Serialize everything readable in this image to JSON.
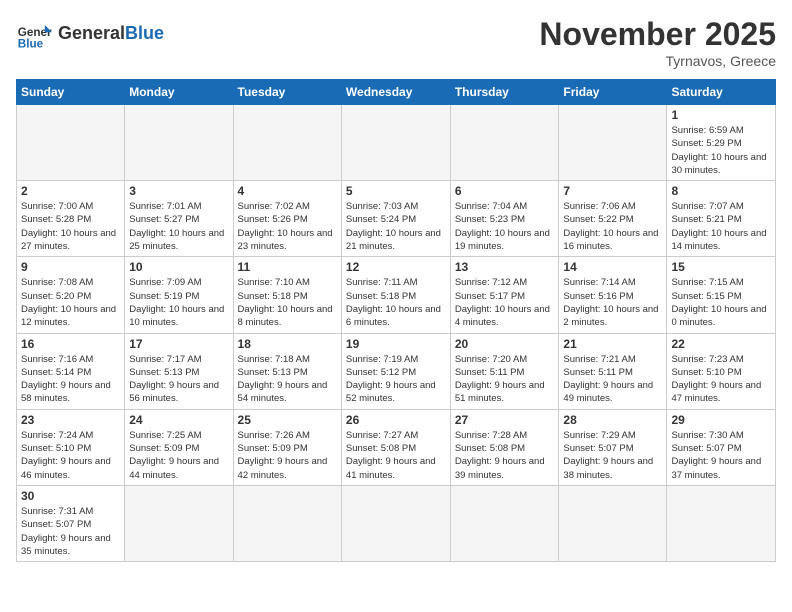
{
  "header": {
    "logo_general": "General",
    "logo_blue": "Blue",
    "month": "November 2025",
    "location": "Tyrnavos, Greece"
  },
  "weekdays": [
    "Sunday",
    "Monday",
    "Tuesday",
    "Wednesday",
    "Thursday",
    "Friday",
    "Saturday"
  ],
  "days": {
    "1": {
      "sunrise": "6:59 AM",
      "sunset": "5:29 PM",
      "daylight": "10 hours and 30 minutes."
    },
    "2": {
      "sunrise": "7:00 AM",
      "sunset": "5:28 PM",
      "daylight": "10 hours and 27 minutes."
    },
    "3": {
      "sunrise": "7:01 AM",
      "sunset": "5:27 PM",
      "daylight": "10 hours and 25 minutes."
    },
    "4": {
      "sunrise": "7:02 AM",
      "sunset": "5:26 PM",
      "daylight": "10 hours and 23 minutes."
    },
    "5": {
      "sunrise": "7:03 AM",
      "sunset": "5:24 PM",
      "daylight": "10 hours and 21 minutes."
    },
    "6": {
      "sunrise": "7:04 AM",
      "sunset": "5:23 PM",
      "daylight": "10 hours and 19 minutes."
    },
    "7": {
      "sunrise": "7:06 AM",
      "sunset": "5:22 PM",
      "daylight": "10 hours and 16 minutes."
    },
    "8": {
      "sunrise": "7:07 AM",
      "sunset": "5:21 PM",
      "daylight": "10 hours and 14 minutes."
    },
    "9": {
      "sunrise": "7:08 AM",
      "sunset": "5:20 PM",
      "daylight": "10 hours and 12 minutes."
    },
    "10": {
      "sunrise": "7:09 AM",
      "sunset": "5:19 PM",
      "daylight": "10 hours and 10 minutes."
    },
    "11": {
      "sunrise": "7:10 AM",
      "sunset": "5:18 PM",
      "daylight": "10 hours and 8 minutes."
    },
    "12": {
      "sunrise": "7:11 AM",
      "sunset": "5:18 PM",
      "daylight": "10 hours and 6 minutes."
    },
    "13": {
      "sunrise": "7:12 AM",
      "sunset": "5:17 PM",
      "daylight": "10 hours and 4 minutes."
    },
    "14": {
      "sunrise": "7:14 AM",
      "sunset": "5:16 PM",
      "daylight": "10 hours and 2 minutes."
    },
    "15": {
      "sunrise": "7:15 AM",
      "sunset": "5:15 PM",
      "daylight": "10 hours and 0 minutes."
    },
    "16": {
      "sunrise": "7:16 AM",
      "sunset": "5:14 PM",
      "daylight": "9 hours and 58 minutes."
    },
    "17": {
      "sunrise": "7:17 AM",
      "sunset": "5:13 PM",
      "daylight": "9 hours and 56 minutes."
    },
    "18": {
      "sunrise": "7:18 AM",
      "sunset": "5:13 PM",
      "daylight": "9 hours and 54 minutes."
    },
    "19": {
      "sunrise": "7:19 AM",
      "sunset": "5:12 PM",
      "daylight": "9 hours and 52 minutes."
    },
    "20": {
      "sunrise": "7:20 AM",
      "sunset": "5:11 PM",
      "daylight": "9 hours and 51 minutes."
    },
    "21": {
      "sunrise": "7:21 AM",
      "sunset": "5:11 PM",
      "daylight": "9 hours and 49 minutes."
    },
    "22": {
      "sunrise": "7:23 AM",
      "sunset": "5:10 PM",
      "daylight": "9 hours and 47 minutes."
    },
    "23": {
      "sunrise": "7:24 AM",
      "sunset": "5:10 PM",
      "daylight": "9 hours and 46 minutes."
    },
    "24": {
      "sunrise": "7:25 AM",
      "sunset": "5:09 PM",
      "daylight": "9 hours and 44 minutes."
    },
    "25": {
      "sunrise": "7:26 AM",
      "sunset": "5:09 PM",
      "daylight": "9 hours and 42 minutes."
    },
    "26": {
      "sunrise": "7:27 AM",
      "sunset": "5:08 PM",
      "daylight": "9 hours and 41 minutes."
    },
    "27": {
      "sunrise": "7:28 AM",
      "sunset": "5:08 PM",
      "daylight": "9 hours and 39 minutes."
    },
    "28": {
      "sunrise": "7:29 AM",
      "sunset": "5:07 PM",
      "daylight": "9 hours and 38 minutes."
    },
    "29": {
      "sunrise": "7:30 AM",
      "sunset": "5:07 PM",
      "daylight": "9 hours and 37 minutes."
    },
    "30": {
      "sunrise": "7:31 AM",
      "sunset": "5:07 PM",
      "daylight": "9 hours and 35 minutes."
    }
  }
}
